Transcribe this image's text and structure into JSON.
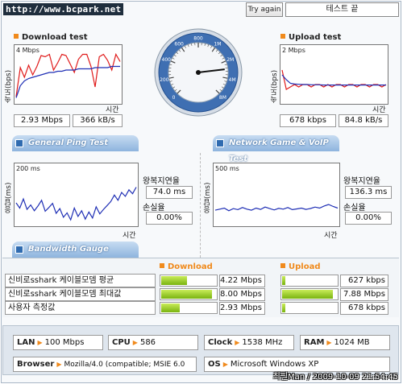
{
  "header": {
    "site_title": "http://www.bcpark.net",
    "try_again": "Try again",
    "end_label": "테스트 끝"
  },
  "download": {
    "title": "Download test",
    "y_label": "속도(bps)",
    "scale": "4 Mbps",
    "x_label": "시간",
    "value_bps": "2.93 Mbps",
    "value_bytes": "366 kB/s"
  },
  "upload": {
    "title": "Upload test",
    "y_label": "속도(bps)",
    "scale": "2 Mbps",
    "x_label": "시간",
    "value_bps": "678 kbps",
    "value_bytes": "84.8 kB/s"
  },
  "ping": {
    "tab_label": "General Ping Test",
    "y_label": "응답(ms)",
    "scale": "200 ms",
    "x_label": "시간",
    "rtt_label": "왕복지연율",
    "rtt_value": "74.0 ms",
    "loss_label": "손실율",
    "loss_value": "0.00%"
  },
  "game": {
    "tab_label": "Network Game & VoIP Test",
    "y_label": "응답(ms)",
    "scale": "500 ms",
    "x_label": "시간",
    "rtt_label": "왕복지연율",
    "rtt_value": "136.3 ms",
    "loss_label": "손실율",
    "loss_value": "0.00%"
  },
  "gauge": {
    "ticks": [
      "0",
      "200",
      "400",
      "600",
      "800",
      "1M",
      "2M",
      "4M",
      "8M"
    ],
    "needle_value_mbps": 2.93
  },
  "bandwidth": {
    "tab_label": "Bandwidth Gauge",
    "download_header": "Download",
    "upload_header": "Upload",
    "rows": [
      {
        "label": "신비로sshark 케이블모뎀 평균",
        "down": "4.22 Mbps",
        "down_level": 0.47,
        "up": "627 kbps",
        "up_level": 0.05
      },
      {
        "label": "신비로sshark 케이블모뎀 최대값",
        "down": "8.00 Mbps",
        "down_level": 0.92,
        "up": "7.88 Mbps",
        "up_level": 0.92
      },
      {
        "label": "사용자 측정값",
        "down": "2.93 Mbps",
        "down_level": 0.34,
        "up": "678 kbps",
        "up_level": 0.05
      }
    ]
  },
  "system": {
    "lan_label": "LAN",
    "lan_value": "100 Mbps",
    "cpu_label": "CPU",
    "cpu_value": "586",
    "clock_label": "Clock",
    "clock_value": "1538 MHz",
    "ram_label": "RAM",
    "ram_value": "1024 MB",
    "browser_label": "Browser",
    "browser_value": "Mozilla/4.0 (compatible; MSIE 6.0",
    "os_label": "OS",
    "os_value": "Microsoft Windows XP"
  },
  "footer": {
    "stamp": "최필Man / 2009-10-09 21:54:45"
  },
  "colors": {
    "accent": "#f08a1c",
    "tab": "#8eb4de",
    "series_red": "#e01b1b",
    "series_blue": "#1f2fb5",
    "bar": "#79b30f"
  },
  "chart_data": [
    {
      "type": "line",
      "title": "Download test",
      "ylabel": "속도(bps)",
      "xlabel": "시간",
      "ylim": [
        0,
        4
      ],
      "series": [
        {
          "values": [
            0.4,
            2.8,
            2.0,
            3.0,
            2.2,
            2.9,
            3.8,
            3.7,
            3.9,
            2.6,
            3.2,
            3.9,
            3.8,
            3.1,
            2.4,
            3.5,
            3.9,
            3.9,
            2.9,
            1.2,
            3.7,
            3.9,
            3.4,
            2.6,
            3.9,
            3.3
          ]
        },
        {
          "values": [
            0.3,
            1.3,
            1.7,
            1.9,
            2.0,
            2.1,
            2.2,
            2.3,
            2.4,
            2.4,
            2.5,
            2.5,
            2.6,
            2.6,
            2.6,
            2.7,
            2.7,
            2.7,
            2.7,
            2.8,
            2.8,
            2.8,
            2.8,
            2.9,
            2.9,
            2.9
          ]
        }
      ]
    },
    {
      "type": "line",
      "title": "Upload test",
      "ylabel": "속도(bps)",
      "xlabel": "시간",
      "ylim": [
        0,
        2
      ],
      "series": [
        {
          "values": [
            1.3,
            0.5,
            0.6,
            0.7,
            0.6,
            0.7,
            0.7,
            0.6,
            0.7,
            0.7,
            0.6,
            0.7,
            0.6,
            0.7,
            0.7,
            0.6,
            0.7,
            0.7,
            0.6,
            0.7,
            0.7,
            0.6,
            0.7,
            0.7,
            0.6,
            0.7
          ]
        },
        {
          "values": [
            1.1,
            0.9,
            0.75,
            0.72,
            0.71,
            0.7,
            0.7,
            0.69,
            0.69,
            0.69,
            0.68,
            0.68,
            0.68,
            0.68,
            0.68,
            0.68,
            0.68,
            0.68,
            0.68,
            0.68,
            0.68,
            0.68,
            0.68,
            0.68,
            0.68,
            0.68
          ]
        }
      ]
    },
    {
      "type": "line",
      "title": "General Ping Test",
      "ylabel": "응답(ms)",
      "xlabel": "시간",
      "ylim": [
        0,
        200
      ],
      "series": [
        {
          "values": [
            80,
            60,
            95,
            55,
            72,
            50,
            68,
            90,
            48,
            62,
            78,
            40,
            58,
            25,
            42,
            15,
            60,
            28,
            50,
            18,
            45,
            22,
            65,
            38,
            55,
            70,
            85,
            110,
            90,
            120,
            105,
            130,
            115,
            140
          ]
        }
      ]
    },
    {
      "type": "line",
      "title": "Network Game & VoIP Test",
      "ylabel": "응답(ms)",
      "xlabel": "시간",
      "ylim": [
        0,
        500
      ],
      "series": [
        {
          "values": [
            130,
            140,
            150,
            125,
            145,
            135,
            155,
            140,
            130,
            150,
            138,
            160,
            145,
            132,
            148,
            140,
            155,
            135,
            142,
            150,
            138,
            146,
            160,
            150,
            170,
            185,
            165,
            150
          ]
        }
      ]
    }
  ]
}
